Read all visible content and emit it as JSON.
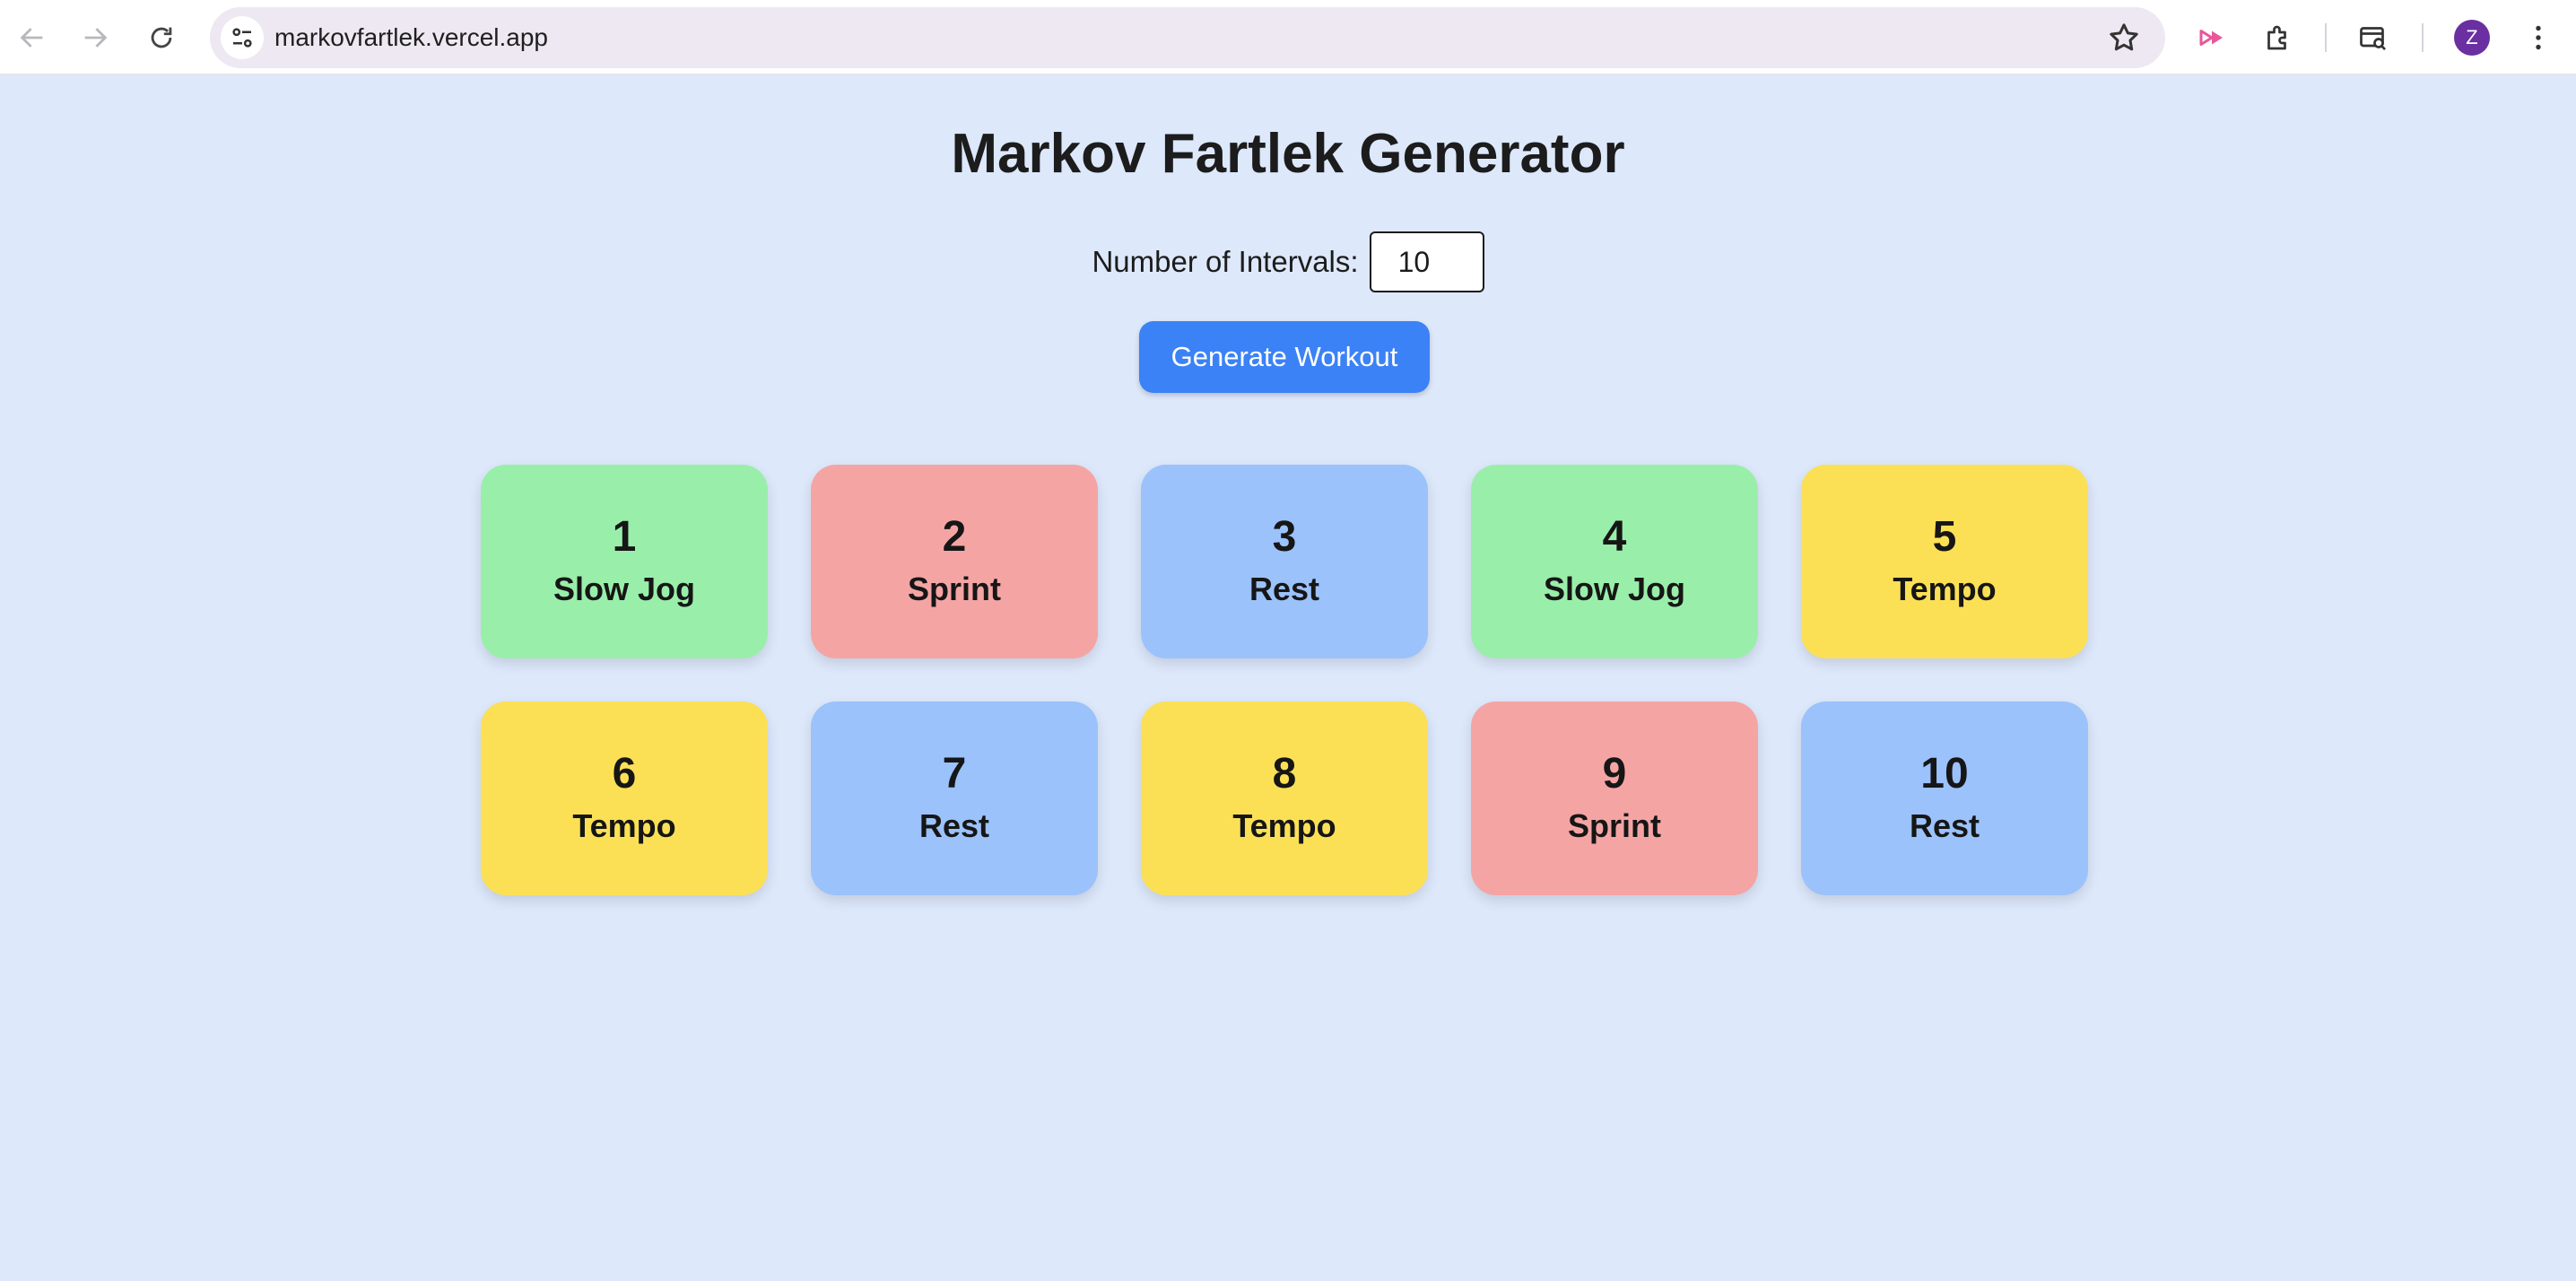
{
  "browser": {
    "url": "markovfartlek.vercel.app",
    "profile_initial": "Z"
  },
  "page": {
    "title": "Markov Fartlek Generator",
    "intervals_label": "Number of Intervals:",
    "intervals_value": "10",
    "generate_label": "Generate Workout"
  },
  "colors": {
    "Slow Jog": "#99efa9",
    "Sprint": "#f5a4a4",
    "Rest": "#9bc2fb",
    "Tempo": "#fbe056"
  },
  "intervals": [
    {
      "number": "1",
      "label": "Slow Jog"
    },
    {
      "number": "2",
      "label": "Sprint"
    },
    {
      "number": "3",
      "label": "Rest"
    },
    {
      "number": "4",
      "label": "Slow Jog"
    },
    {
      "number": "5",
      "label": "Tempo"
    },
    {
      "number": "6",
      "label": "Tempo"
    },
    {
      "number": "7",
      "label": "Rest"
    },
    {
      "number": "8",
      "label": "Tempo"
    },
    {
      "number": "9",
      "label": "Sprint"
    },
    {
      "number": "10",
      "label": "Rest"
    }
  ]
}
